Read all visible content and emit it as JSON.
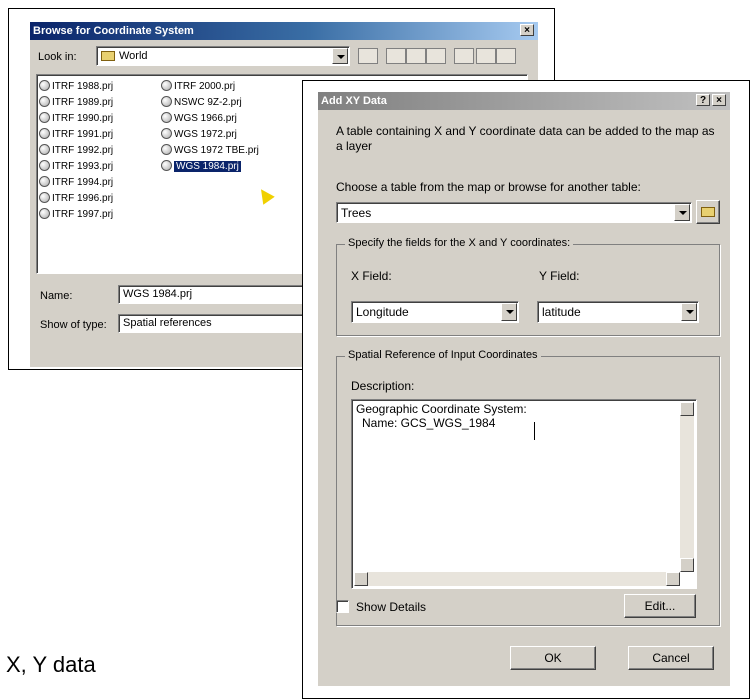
{
  "browse": {
    "title": "Browse for Coordinate System",
    "close_label": "×",
    "look_in_label": "Look in:",
    "look_in_value": "World",
    "files_col1": [
      "ITRF 1988.prj",
      "ITRF 1989.prj",
      "ITRF 1990.prj",
      "ITRF 1991.prj",
      "ITRF 1992.prj",
      "ITRF 1993.prj",
      "ITRF 1994.prj",
      "ITRF 1996.prj",
      "ITRF 1997.prj"
    ],
    "files_col2": [
      "ITRF 2000.prj",
      "NSWC 9Z-2.prj",
      "WGS 1966.prj",
      "WGS 1972.prj",
      "WGS 1972 TBE.prj",
      "WGS 1984.prj"
    ],
    "selected_file": "WGS 1984.prj",
    "name_label": "Name:",
    "name_value": "WGS 1984.prj",
    "type_label": "Show of type:",
    "type_value": "Spatial references"
  },
  "addxy": {
    "title": "Add XY Data",
    "help_label": "?",
    "close_label": "×",
    "intro": "A table containing X and Y coordinate data can be added to the map as a layer",
    "choose_label": "Choose a table from the map or browse for another table:",
    "table_value": "Trees",
    "fields_group": "Specify the fields for the X and Y coordinates:",
    "x_label": "X Field:",
    "y_label": "Y Field:",
    "x_value": "Longitude",
    "y_value": "latitude",
    "spatial_group": "Spatial Reference of Input Coordinates",
    "description_label": "Description:",
    "description_line1": "Geographic Coordinate System:",
    "description_line2": "Name: GCS_WGS_1984",
    "show_details_label": "Show Details",
    "edit_label": "Edit...",
    "ok_label": "OK",
    "cancel_label": "Cancel"
  },
  "caption": "X, Y data"
}
